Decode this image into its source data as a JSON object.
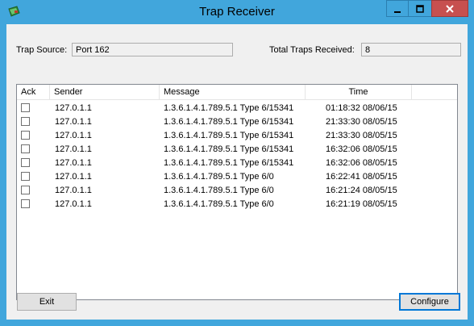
{
  "window": {
    "title": "Trap Receiver",
    "colors": {
      "frame": "#41a6dc",
      "close": "#c7504f",
      "client": "#f0f0f0"
    }
  },
  "titlebar_buttons": {
    "minimize_icon": "minimize-icon",
    "maximize_icon": "maximize-icon",
    "close_icon": "close-icon"
  },
  "trap_source": {
    "label": "Trap Source:",
    "value": "Port  162"
  },
  "total_traps": {
    "label": "Total Traps Received:",
    "value": "8"
  },
  "table": {
    "columns": [
      "Ack",
      "Sender",
      "Message",
      "Time"
    ],
    "rows": [
      {
        "ack": false,
        "sender": "127.0.1.1",
        "message": "1.3.6.1.4.1.789.5.1  Type 6/15341",
        "time": "01:18:32 08/06/15"
      },
      {
        "ack": false,
        "sender": "127.0.1.1",
        "message": "1.3.6.1.4.1.789.5.1  Type 6/15341",
        "time": "21:33:30 08/05/15"
      },
      {
        "ack": false,
        "sender": "127.0.1.1",
        "message": "1.3.6.1.4.1.789.5.1  Type 6/15341",
        "time": "21:33:30 08/05/15"
      },
      {
        "ack": false,
        "sender": "127.0.1.1",
        "message": "1.3.6.1.4.1.789.5.1  Type 6/15341",
        "time": "16:32:06 08/05/15"
      },
      {
        "ack": false,
        "sender": "127.0.1.1",
        "message": "1.3.6.1.4.1.789.5.1  Type 6/15341",
        "time": "16:32:06 08/05/15"
      },
      {
        "ack": false,
        "sender": "127.0.1.1",
        "message": "1.3.6.1.4.1.789.5.1  Type 6/0",
        "time": "16:22:41 08/05/15"
      },
      {
        "ack": false,
        "sender": "127.0.1.1",
        "message": "1.3.6.1.4.1.789.5.1  Type 6/0",
        "time": "16:21:24 08/05/15"
      },
      {
        "ack": false,
        "sender": "127.0.1.1",
        "message": "1.3.6.1.4.1.789.5.1  Type 6/0",
        "time": "16:21:19 08/05/15"
      }
    ]
  },
  "buttons": {
    "exit": "Exit",
    "configure": "Configure"
  }
}
